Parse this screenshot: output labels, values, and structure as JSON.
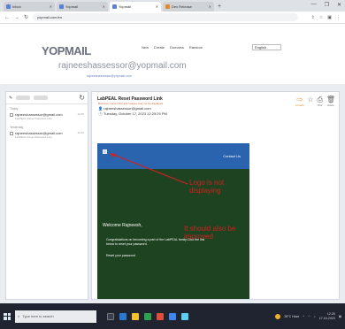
{
  "browser": {
    "tabs": [
      {
        "label": "Inbox",
        "favicon": "mail-icon",
        "active": false
      },
      {
        "label": "Yopmail",
        "favicon": "mail-icon",
        "active": false
      },
      {
        "label": "Yopmail",
        "favicon": "mail-icon",
        "active": true
      },
      {
        "label": "Dev Release",
        "favicon": "orange-icon",
        "active": false
      }
    ],
    "new_tab": "+",
    "url": "yopmail.com/en",
    "window_controls": [
      "—",
      "❐",
      "✕"
    ]
  },
  "yopmail": {
    "logo": "YOPMAIL",
    "top_links": [
      "New",
      "Create",
      "Domains",
      "Random"
    ],
    "language": "English",
    "inbox_address": "rajneeshassessor@yopmail.com",
    "alias_line": "rajneeshassessor@yopmail.com"
  },
  "inbox": {
    "groups": [
      {
        "label": "Today",
        "items": [
          {
            "from": "rajneeshassessor@gmail.com",
            "subject": "LabPEAL Reset Password Link",
            "time": "12:25"
          }
        ]
      },
      {
        "label": "Yesterday",
        "items": [
          {
            "from": "rajneeshassessor@gmail.com",
            "subject": "LabPEAL Reset Password Link",
            "time": "16:40"
          }
        ]
      }
    ]
  },
  "reader": {
    "subject": "LabPEAL Reset Password Link",
    "warning": "Bounces: some links and images may not be displayed",
    "from": "rajneeshassessor@gmail.com",
    "date": "Tuesday, October 17, 2023 12:25:29 PM",
    "tools": [
      {
        "label": "Forward",
        "icon": "forward-icon"
      },
      {
        "label": "",
        "icon": "star-icon"
      },
      {
        "label": "Print",
        "icon": "print-icon"
      },
      {
        "label": "Delete",
        "icon": "trash-icon"
      }
    ]
  },
  "email_body": {
    "contact_label": "Contact Us",
    "welcome": "Welcome Rajneesh,",
    "intro": "Congratulations on becoming a part of the LabPEAL family.Click the link below to reset your password.",
    "reset_line": "Reset your password"
  },
  "annotations": {
    "logo_note": "Logo is not displaying",
    "alignment_note": "It should also be improved"
  },
  "taskbar": {
    "search_placeholder": "Type here to search",
    "weather": "26°C Haze",
    "time": "12:25",
    "date": "17-10-2023"
  },
  "colors": {
    "email_header": "#2b64ae",
    "email_body": "#1e4320",
    "annotation": "#d32020",
    "accent": "#e58b2a"
  }
}
